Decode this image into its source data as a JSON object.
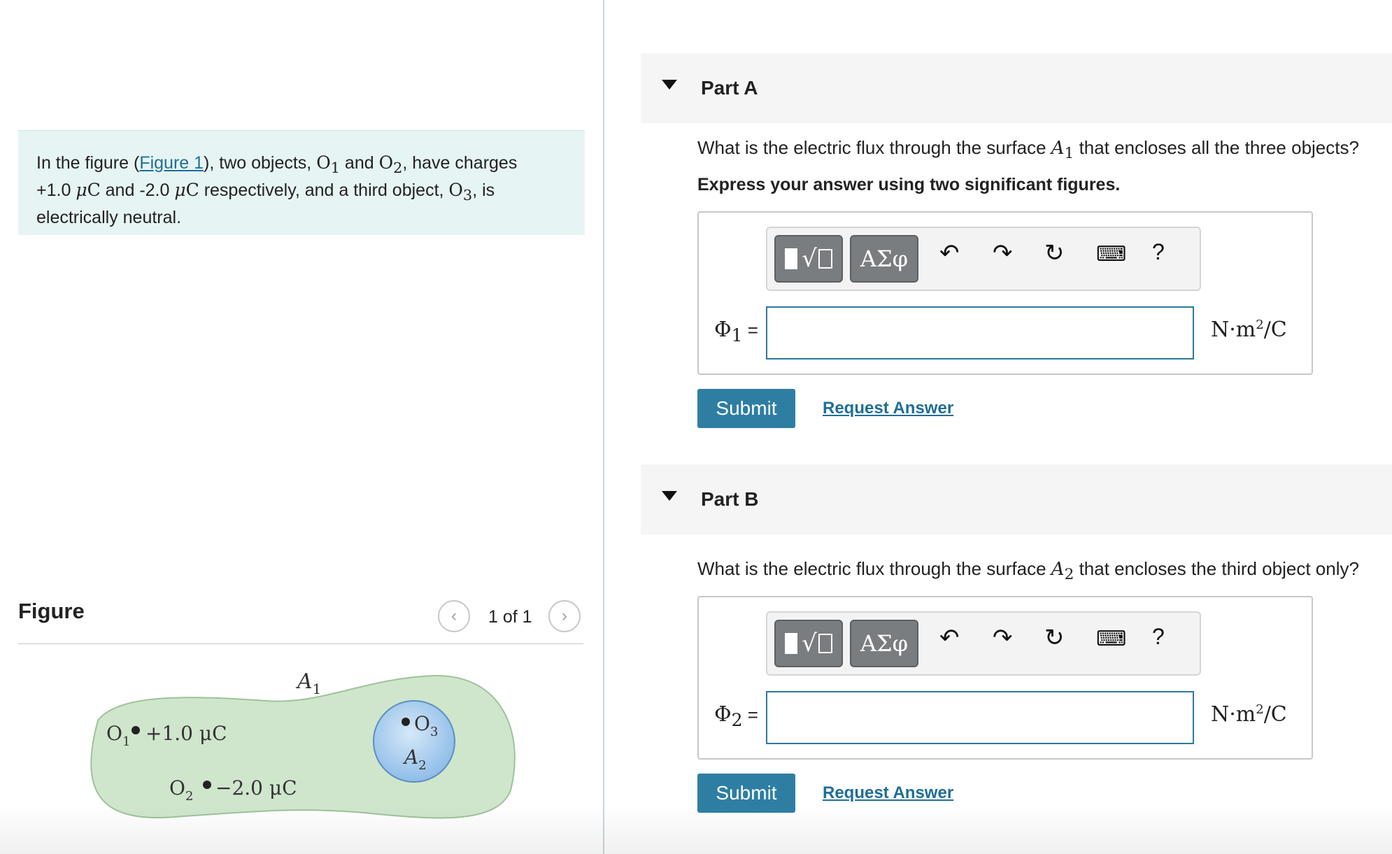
{
  "problem": {
    "text_1": "In the figure (",
    "figure_link": "Figure 1",
    "text_2": "), two objects, ",
    "o1": "O",
    "o1_sub": "1",
    "text_3": " and ",
    "o2": "O",
    "o2_sub": "2",
    "text_4": ", have charges ",
    "charge1": "+1.0",
    "unit_mu": "μ",
    "unit_c": "C",
    "text_5": " and ",
    "charge2": "-2.0",
    "text_6": " respectively, and a third object, ",
    "o3": "O",
    "o3_sub": "3",
    "text_7": ", is electrically neutral."
  },
  "figure": {
    "heading": "Figure",
    "pager": "1 of 1",
    "prev_icon": "chevron-left-icon",
    "next_icon": "chevron-right-icon",
    "label_a1": "A",
    "label_a1_sub": "1",
    "label_o1": "O",
    "label_o1_sub": "1",
    "label_o1_charge": "+1.0 μC",
    "label_o2": "O",
    "label_o2_sub": "2",
    "label_o2_charge": "−2.0 μC",
    "label_o3": "O",
    "label_o3_sub": "3",
    "label_a2": "A",
    "label_a2_sub": "2",
    "colors": {
      "outer_fill": "#cfe6cc",
      "outer_stroke": "#9ec29b",
      "inner_fill": "#a9cdee",
      "inner_stroke": "#5b8fc4"
    }
  },
  "parts": [
    {
      "title": "Part A",
      "question_pre": "What is the electric flux through the surface ",
      "question_sym": "A",
      "question_sub": "1",
      "question_post": " that encloses all the three objects?",
      "instruction": "Express your answer using two significant figures.",
      "toolbar": {
        "templates_label": "√",
        "greek_label": "ΑΣφ",
        "undo_icon": "undo-icon",
        "redo_icon": "redo-icon",
        "reset_icon": "reset-icon",
        "keyboard_icon": "keyboard-icon",
        "help_label": "?"
      },
      "answer_label": "Φ",
      "answer_sub": "1",
      "answer_eq": " =",
      "answer_value": "",
      "units": "N·m",
      "units_sup": "2",
      "units_post": "/C",
      "submit": "Submit",
      "request": "Request Answer"
    },
    {
      "title": "Part B",
      "question_pre": "What is the electric flux through the surface ",
      "question_sym": "A",
      "question_sub": "2",
      "question_post": " that encloses the third object only?",
      "instruction": "",
      "toolbar": {
        "templates_label": "√",
        "greek_label": "ΑΣφ",
        "undo_icon": "undo-icon",
        "redo_icon": "redo-icon",
        "reset_icon": "reset-icon",
        "keyboard_icon": "keyboard-icon",
        "help_label": "?"
      },
      "answer_label": "Φ",
      "answer_sub": "2",
      "answer_eq": " =",
      "answer_value": "",
      "units": "N·m",
      "units_sup": "2",
      "units_post": "/C",
      "submit": "Submit",
      "request": "Request Answer"
    }
  ]
}
